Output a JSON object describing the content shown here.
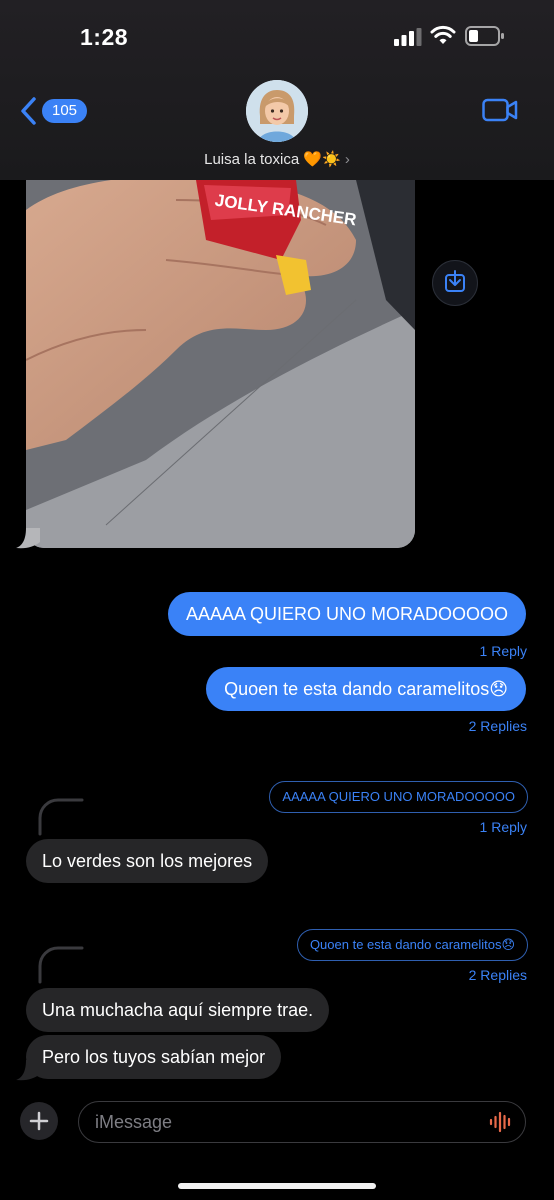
{
  "status_bar": {
    "time": "1:28"
  },
  "header": {
    "back_count": "105",
    "contact_name": "Luisa la toxica 🧡☀️",
    "chevron": "›"
  },
  "photo": {
    "candy_label": "JOLLY RANCHER",
    "save_icon": "save-to-photos-icon"
  },
  "messages": [
    {
      "side": "out",
      "text": "AAAAA QUIERO UNO MORADOOOOO",
      "replies": "1 Reply"
    },
    {
      "side": "out",
      "text": "Quoen te esta dando caramelitos😞",
      "replies": "2 Replies"
    }
  ],
  "threads": [
    {
      "quote": "AAAAA QUIERO UNO MORADOOOOO",
      "replies": "1 Reply",
      "reply": "Lo verdes son los mejores"
    },
    {
      "quote": "Quoen te esta dando caramelitos😞",
      "replies": "2 Replies",
      "reply1": "Una muchacha aquí siempre trae.",
      "reply2": "Pero los tuyos sabían mejor"
    }
  ],
  "composer": {
    "placeholder": "iMessage"
  },
  "colors": {
    "accent": "#3a82f7",
    "incoming": "#262628",
    "background": "#000000"
  }
}
